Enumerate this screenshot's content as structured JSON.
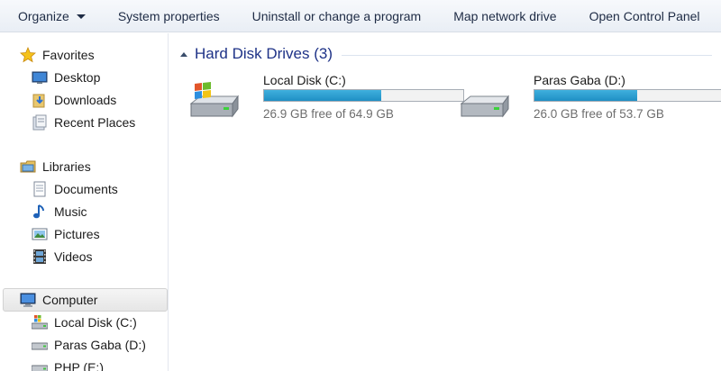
{
  "toolbar": {
    "organize": "Organize",
    "system_properties": "System properties",
    "uninstall": "Uninstall or change a program",
    "map_drive": "Map network drive",
    "control_panel": "Open Control Panel"
  },
  "nav": {
    "favorites": {
      "label": "Favorites",
      "items": [
        "Desktop",
        "Downloads",
        "Recent Places"
      ]
    },
    "libraries": {
      "label": "Libraries",
      "items": [
        "Documents",
        "Music",
        "Pictures",
        "Videos"
      ]
    },
    "computer": {
      "label": "Computer",
      "items": [
        "Local Disk (C:)",
        "Paras Gaba (D:)",
        "PHP (E:)"
      ]
    }
  },
  "group": {
    "title": "Hard Disk Drives (3)"
  },
  "drives": [
    {
      "name": "Local Disk (C:)",
      "free_text": "26.9 GB free of 64.9 GB",
      "used_fraction": 0.586
    },
    {
      "name": "Paras Gaba (D:)",
      "free_text": "26.0 GB free of 53.7 GB",
      "used_fraction": 0.516
    }
  ],
  "colors": {
    "accent_title": "#1e3287",
    "bar_fill": "#2a9dd2"
  }
}
